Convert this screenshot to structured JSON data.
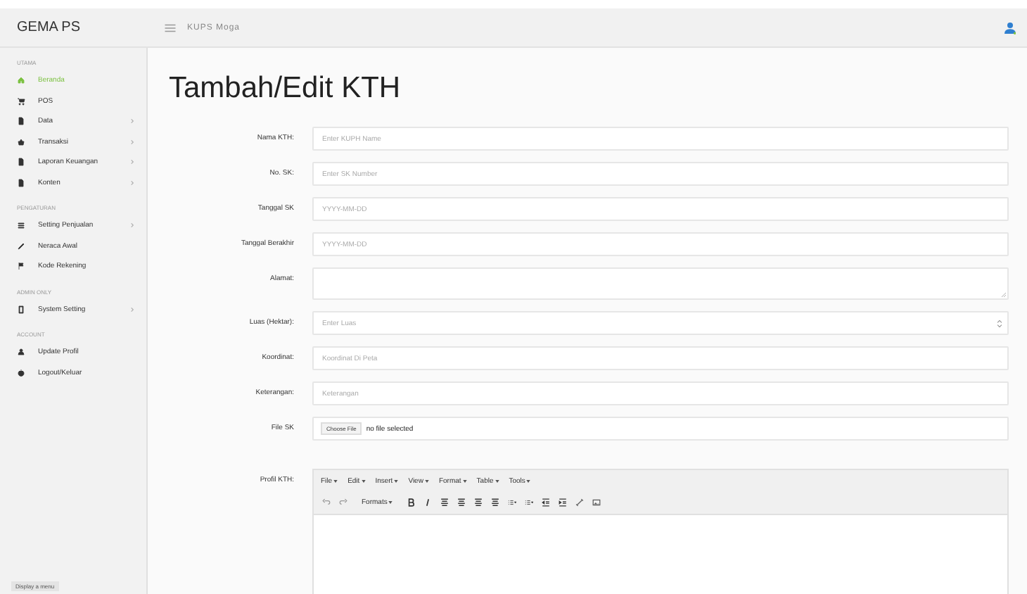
{
  "header": {
    "brand": "GEMA PS",
    "title": "KUPS Moga"
  },
  "sidebar": {
    "sections": [
      {
        "heading": "UTAMA",
        "items": [
          {
            "label": "Beranda",
            "selected": true,
            "expandable": false
          },
          {
            "label": "POS",
            "selected": false,
            "expandable": false
          },
          {
            "label": "Data",
            "selected": false,
            "expandable": true
          },
          {
            "label": "Transaksi",
            "selected": false,
            "expandable": true
          },
          {
            "label": "Laporan Keuangan",
            "selected": false,
            "expandable": true
          },
          {
            "label": "Konten",
            "selected": false,
            "expandable": true
          }
        ]
      },
      {
        "heading": "PENGATURAN",
        "items": [
          {
            "label": "Setting Penjualan",
            "selected": false,
            "expandable": true
          },
          {
            "label": "Neraca Awal",
            "selected": false,
            "expandable": false
          },
          {
            "label": "Kode Rekening",
            "selected": false,
            "expandable": false
          }
        ]
      },
      {
        "heading": "ADMIN ONLY",
        "items": [
          {
            "label": "System Setting",
            "selected": false,
            "expandable": true
          }
        ]
      },
      {
        "heading": "ACCOUNT",
        "items": [
          {
            "label": "Update Profil",
            "selected": false,
            "expandable": false
          },
          {
            "label": "Logout/Keluar",
            "selected": false,
            "expandable": false
          }
        ]
      }
    ],
    "footer": "Display a menu"
  },
  "page": {
    "title": "Tambah/Edit KTH",
    "fields": [
      {
        "kind": "text",
        "label": "Nama KTH:",
        "placeholder": "Enter KUPH Name"
      },
      {
        "kind": "text",
        "label": "No. SK:",
        "placeholder": "Enter SK Number"
      },
      {
        "kind": "text",
        "label": "Tanggal SK",
        "placeholder": "YYYY-MM-DD"
      },
      {
        "kind": "text",
        "label": "Tanggal Berakhir",
        "placeholder": "YYYY-MM-DD"
      },
      {
        "kind": "textarea",
        "label": "Alamat:"
      },
      {
        "kind": "number",
        "label": "Luas (Hektar):",
        "placeholder": "Enter Luas"
      },
      {
        "kind": "text",
        "label": "Koordinat:",
        "placeholder": "Koordinat Di Peta"
      },
      {
        "kind": "text",
        "label": "Keterangan:",
        "placeholder": "Keterangan"
      },
      {
        "kind": "file",
        "label": "File SK",
        "button": "Choose File",
        "status": "no file selected"
      },
      {
        "kind": "editor",
        "label": "Profil KTH:",
        "menus": [
          "File",
          "Edit",
          "Insert",
          "View",
          "Format",
          "Table",
          "Tools"
        ],
        "formats": "Formats"
      }
    ]
  }
}
